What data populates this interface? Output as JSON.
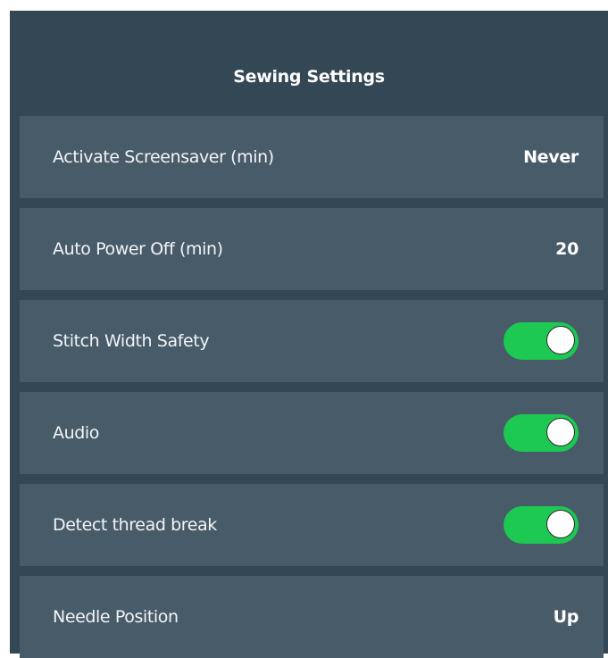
{
  "header": {
    "title": "Sewing Settings"
  },
  "settings": [
    {
      "label": "Activate Screensaver (min)",
      "type": "value",
      "value": "Never"
    },
    {
      "label": "Auto Power Off (min)",
      "type": "value",
      "value": "20"
    },
    {
      "label": "Stitch Width Safety",
      "type": "toggle",
      "on": true
    },
    {
      "label": "Audio",
      "type": "toggle",
      "on": true
    },
    {
      "label": "Detect thread break",
      "type": "toggle",
      "on": true
    },
    {
      "label": "Needle Position",
      "type": "value",
      "value": "Up"
    }
  ],
  "colors": {
    "panel_background": "#344754",
    "row_background": "#485b69",
    "toggle_on": "#1dc952",
    "text": "#ffffff"
  }
}
